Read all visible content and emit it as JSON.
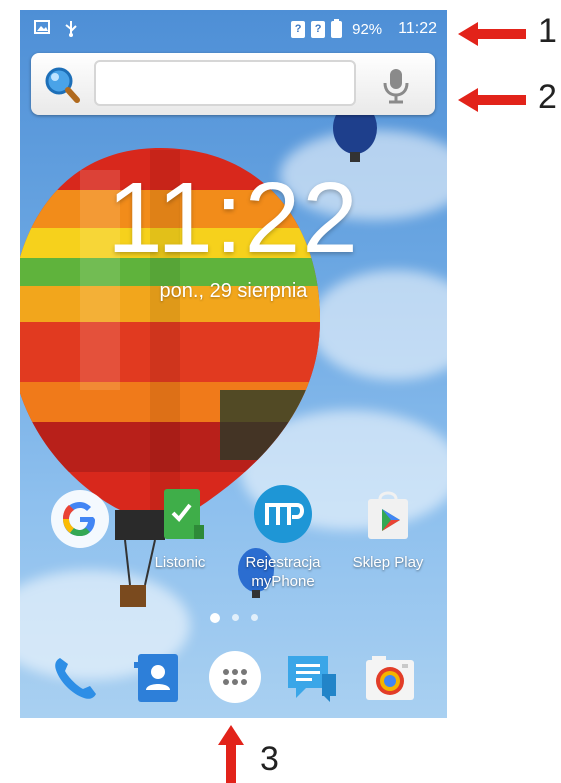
{
  "status_bar": {
    "battery": "92%",
    "time": "11:22",
    "icons": [
      "image-icon",
      "usb-icon",
      "sim1-icon",
      "sim2-icon",
      "battery-icon"
    ]
  },
  "search_bar": {
    "search_icon": "magnifier-icon",
    "mic_icon": "microphone-icon",
    "input_value": ""
  },
  "clock": {
    "time": "11:22",
    "date": "pon., 29 sierpnia"
  },
  "apps": [
    {
      "label": "",
      "icon": "google-icon"
    },
    {
      "label": "Listonic",
      "icon": "listonic-icon"
    },
    {
      "label": "Rejestracja myPhone",
      "icon": "myphone-icon"
    },
    {
      "label": "Sklep Play",
      "icon": "play-store-icon"
    }
  ],
  "page_indicator": {
    "count": 3,
    "active": 0
  },
  "dock": [
    "phone-icon",
    "contacts-icon",
    "app-drawer-icon",
    "messages-icon",
    "camera-icon"
  ],
  "annotations": {
    "one": "1",
    "two": "2",
    "three": "3",
    "arrow_color": "#e2231a"
  },
  "colors": {
    "sky": "#6aa6e2",
    "accent_green": "#3fae49",
    "accent_red": "#e2231a"
  }
}
